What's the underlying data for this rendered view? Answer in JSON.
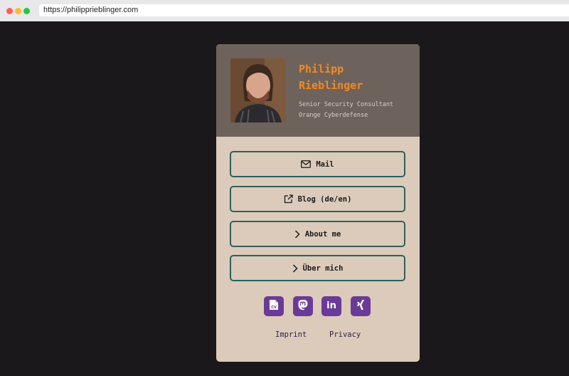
{
  "browser": {
    "url": "https://philipprieblinger.com"
  },
  "profile": {
    "name_line1": "Philipp",
    "name_line2": "Rieblinger",
    "role": "Senior Security Consultant",
    "company": "Orange Cyberdefense",
    "photo_alt": "Philipp Rieblinger"
  },
  "buttons": [
    {
      "label": "Mail",
      "icon": "mail-icon"
    },
    {
      "label": "Blog (de/en)",
      "icon": "external-link-icon"
    },
    {
      "label": "About me",
      "icon": "chevron-right-icon"
    },
    {
      "label": "Über mich",
      "icon": "chevron-right-icon"
    }
  ],
  "socials": [
    {
      "icon": "cv-document-icon",
      "label": "CV"
    },
    {
      "icon": "mastodon-icon"
    },
    {
      "icon": "linkedin-icon",
      "label": "in"
    },
    {
      "icon": "xing-icon"
    }
  ],
  "footer": {
    "imprint": "Imprint",
    "privacy": "Privacy"
  },
  "colors": {
    "page_background": "#1a181a",
    "card_background": "#dccbba",
    "header_background": "#6e625c",
    "name_accent": "#f08a24",
    "button_border": "#2f5f5c",
    "social_icon_background": "#6a3a98",
    "footer_link": "#2a1f4a"
  }
}
